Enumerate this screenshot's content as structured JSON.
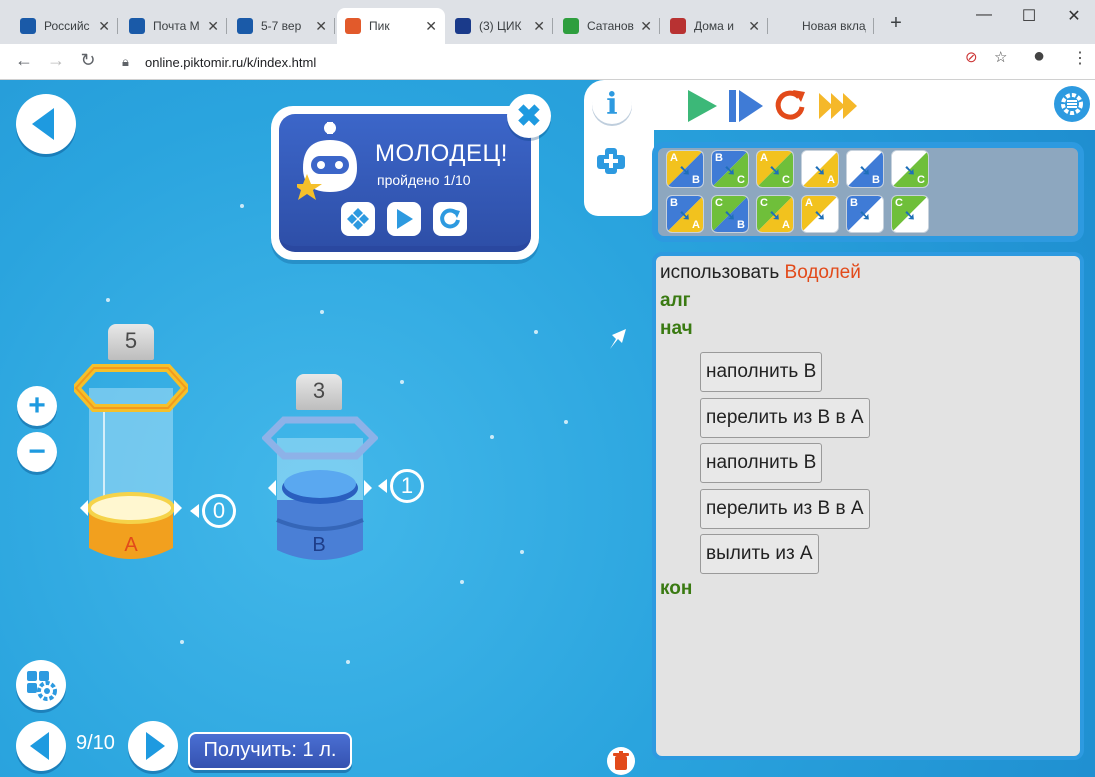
{
  "browser": {
    "tabs": [
      {
        "title": "Российс",
        "active": false,
        "favicon_color": "#1a5aa8"
      },
      {
        "title": "Почта М",
        "active": false,
        "favicon_color": "#1a5aa8"
      },
      {
        "title": "5-7 вер",
        "active": false,
        "favicon_color": "#1a5aa8"
      },
      {
        "title": "Пик",
        "active": true,
        "favicon_color": "#e25a2b"
      },
      {
        "title": "(3) ЦИК",
        "active": false,
        "favicon_color": "#1a3a8a"
      },
      {
        "title": "Сатанов",
        "active": false,
        "favicon_color": "#2e9e3e"
      },
      {
        "title": "Дома и",
        "active": false,
        "favicon_color": "#b83232"
      },
      {
        "title": "Новая вклад",
        "active": false,
        "favicon_color": "#dee1e6"
      }
    ],
    "tab_close": "✕",
    "new_tab": "+",
    "window_controls": {
      "minimize": "—",
      "maximize": "☐",
      "close": "✕"
    },
    "nav": {
      "back": "←",
      "forward": "→",
      "reload": "↻"
    },
    "url": "online.piktomir.ru/k/index.html"
  },
  "game": {
    "popup": {
      "title": "МОЛОДЕЦ!",
      "subtitle": "пройдено 1/10",
      "close_icon": "✖"
    },
    "containers": [
      {
        "capacity_badge": "5",
        "label": "А",
        "level": "0",
        "color": "#f2a01e"
      },
      {
        "capacity_badge": "3",
        "label": "В",
        "level": "1",
        "color": "#3f7bd6"
      }
    ],
    "zoom": {
      "plus": "+",
      "minus": "−"
    },
    "level_counter": "9/10",
    "goal": "Получить: 1 л."
  },
  "panel": {
    "info_icon": "i",
    "palette": [
      [
        {
          "a": "А",
          "b": "В",
          "c1": "#f2c21e",
          "c2": "#3f7bd6"
        },
        {
          "a": "В",
          "b": "С",
          "c1": "#3f7bd6",
          "c2": "#6fbf3a"
        },
        {
          "a": "А",
          "b": "С",
          "c1": "#f2c21e",
          "c2": "#6fbf3a"
        },
        {
          "a": "",
          "b": "А",
          "c1": "#ffffff",
          "c2": "#f2c21e"
        },
        {
          "a": "",
          "b": "В",
          "c1": "#ffffff",
          "c2": "#3f7bd6"
        },
        {
          "a": "",
          "b": "С",
          "c1": "#ffffff",
          "c2": "#6fbf3a"
        }
      ],
      [
        {
          "a": "В",
          "b": "А",
          "c1": "#3f7bd6",
          "c2": "#f2c21e"
        },
        {
          "a": "С",
          "b": "В",
          "c1": "#6fbf3a",
          "c2": "#3f7bd6"
        },
        {
          "a": "С",
          "b": "А",
          "c1": "#6fbf3a",
          "c2": "#f2c21e"
        },
        {
          "a": "А",
          "b": "",
          "c1": "#f2c21e",
          "c2": "#ffffff"
        },
        {
          "a": "В",
          "b": "",
          "c1": "#3f7bd6",
          "c2": "#ffffff"
        },
        {
          "a": "С",
          "b": "",
          "c1": "#6fbf3a",
          "c2": "#ffffff"
        }
      ]
    ],
    "program": {
      "use_keyword": "использовать",
      "executor": "Водолей",
      "alg": "алг",
      "begin": "нач",
      "commands": [
        "наполнить В",
        "перелить из В в А",
        "наполнить В",
        "перелить из В в А",
        "вылить из А"
      ],
      "end": "кон"
    }
  },
  "colors": {
    "accent": "#1e9ae0",
    "keyword": "#3a7a12",
    "executor": "#e24a1a"
  }
}
